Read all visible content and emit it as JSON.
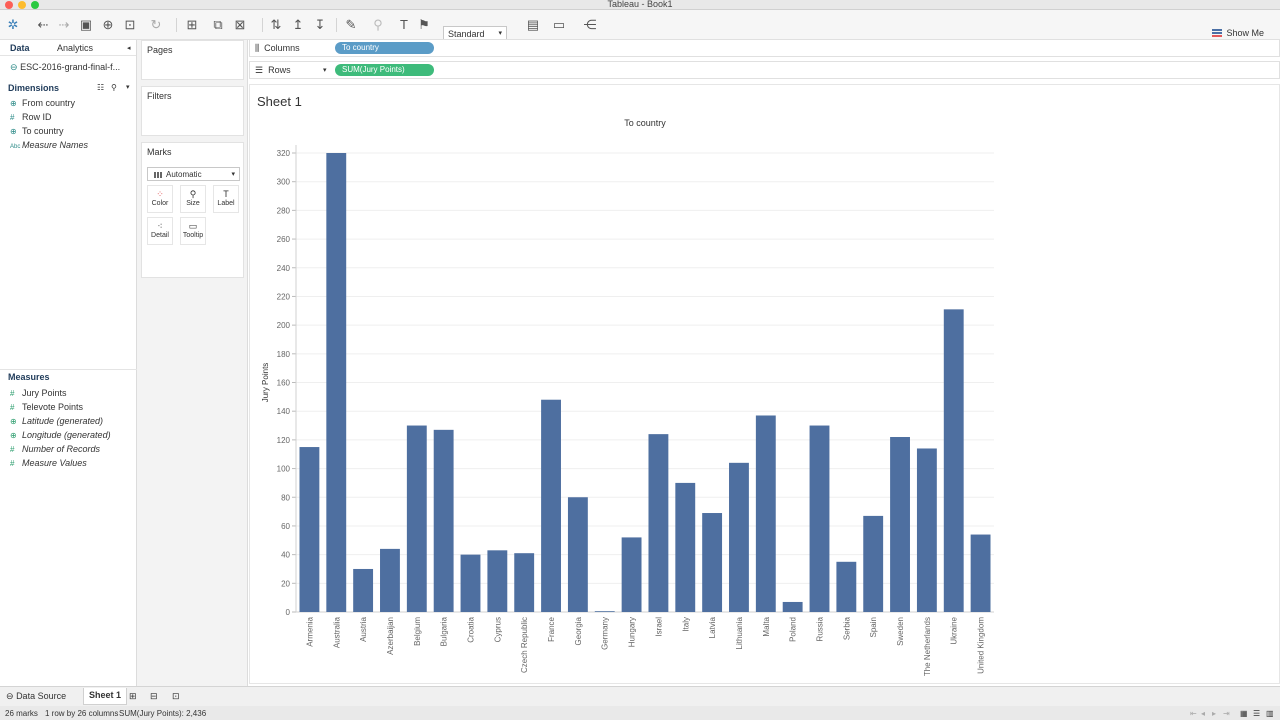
{
  "window": {
    "title": "Tableau - Book1"
  },
  "toolbar": {
    "fit_mode": "Standard",
    "show_me": "Show Me"
  },
  "left_pane": {
    "tabs": [
      "Data",
      "Analytics"
    ],
    "data_source": "ESC-2016-grand-final-f...",
    "dimensions_title": "Dimensions",
    "dimensions": [
      {
        "label": "From country",
        "icon": "globe-icon"
      },
      {
        "label": "Row ID",
        "icon": "hash-icon"
      },
      {
        "label": "To country",
        "icon": "globe-icon"
      },
      {
        "label": "Measure Names",
        "icon": "abc-icon"
      }
    ],
    "measures_title": "Measures",
    "measures": [
      {
        "label": "Jury Points",
        "icon": "hash-icon"
      },
      {
        "label": "Televote Points",
        "icon": "hash-icon"
      },
      {
        "label": "Latitude (generated)",
        "icon": "globe-icon"
      },
      {
        "label": "Longitude (generated)",
        "icon": "globe-icon"
      },
      {
        "label": "Number of Records",
        "icon": "hash-icon"
      },
      {
        "label": "Measure Values",
        "icon": "hash-icon"
      }
    ]
  },
  "cards": {
    "pages": "Pages",
    "filters": "Filters",
    "marks": "Marks",
    "mark_type": "Automatic",
    "mark_buttons": [
      "Color",
      "Size",
      "Label",
      "Detail",
      "Tooltip"
    ]
  },
  "shelves": {
    "columns_label": "Columns",
    "columns_pill": "To country",
    "rows_label": "Rows",
    "rows_pill": "SUM(Jury Points)"
  },
  "sheet": {
    "title": "Sheet 1"
  },
  "chart_data": {
    "type": "bar",
    "title": "To country",
    "xlabel": "",
    "ylabel": "Jury Points",
    "ylim": [
      0,
      320
    ],
    "yticks": [
      0,
      20,
      40,
      60,
      80,
      100,
      120,
      140,
      160,
      180,
      200,
      220,
      240,
      260,
      280,
      300,
      320
    ],
    "grid": true,
    "color": "#4e6fa0",
    "categories": [
      "Armenia",
      "Australia",
      "Austria",
      "Azerbaijan",
      "Belgium",
      "Bulgaria",
      "Croatia",
      "Cyprus",
      "Czech Republic",
      "France",
      "Georgia",
      "Germany",
      "Hungary",
      "Israel",
      "Italy",
      "Latvia",
      "Lithuania",
      "Malta",
      "Poland",
      "Russia",
      "Serbia",
      "Spain",
      "Sweden",
      "The Netherlands",
      "Ukraine",
      "United Kingdom"
    ],
    "values": [
      115,
      320,
      30,
      44,
      130,
      127,
      40,
      43,
      41,
      148,
      80,
      0,
      52,
      124,
      90,
      69,
      104,
      137,
      7,
      130,
      35,
      67,
      122,
      114,
      211,
      54
    ]
  },
  "bottom_tabs": {
    "data_source": "Data Source",
    "sheet": "Sheet 1"
  },
  "status": {
    "marks": "26 marks",
    "dims": "1 row by 26 columns",
    "sum": "SUM(Jury Points): 2,436"
  }
}
